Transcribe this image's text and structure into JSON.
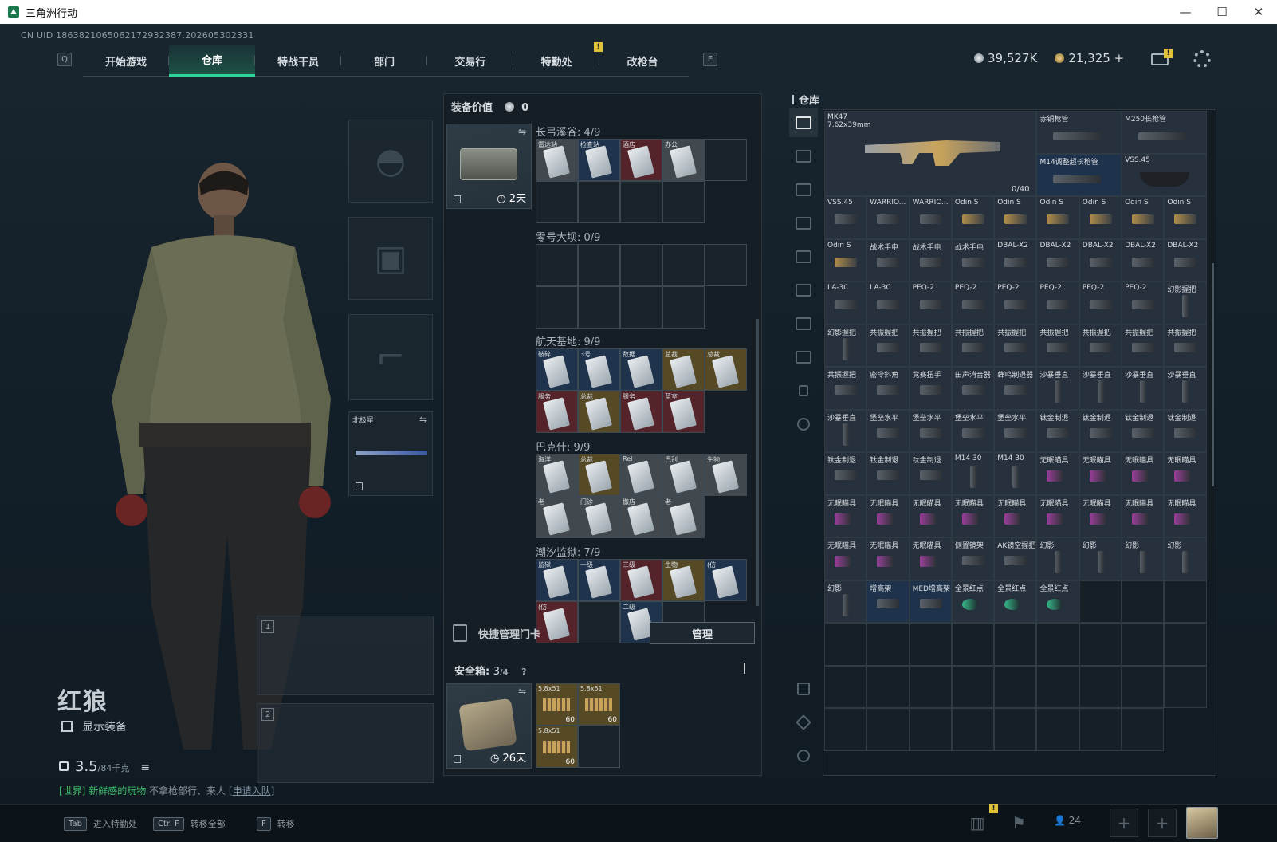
{
  "window": {
    "title": "三角洲行动",
    "controls": [
      "—",
      "☐",
      "✕"
    ]
  },
  "uid": "CN UID 1863821065062172932387.202605302331",
  "nav": {
    "left_key": "Q",
    "right_key": "E",
    "tabs": [
      "开始游戏",
      "仓库",
      "特战干员",
      "部门",
      "交易行",
      "特勤处",
      "改枪台"
    ],
    "active_tab": "仓库",
    "badge": "!"
  },
  "currency": {
    "silver": "39,527K",
    "gold": "21,325",
    "add": "+"
  },
  "mail_badge": "!",
  "character": {
    "name": "红狼",
    "show_gear": "显示装备",
    "weight": "3.5",
    "weight_max": "/84千克"
  },
  "chat": {
    "channel": "[世界]",
    "name": "新鲜感的玩物",
    "text": "不拿枪部行、来人",
    "link": "[申请入队]"
  },
  "gear": {
    "item_label": "北极星"
  },
  "weapon_slots": [
    "1",
    "2"
  ],
  "equip_value": {
    "label": "装备价值",
    "value": "0"
  },
  "card_case": {
    "timer": "2天"
  },
  "card_sections": [
    {
      "title": "长弓溪谷: 4/9",
      "cells": [
        {
          "l": "雷达站",
          "c": "w"
        },
        {
          "l": "检查站",
          "c": "b"
        },
        {
          "l": "酒店",
          "c": "r"
        },
        {
          "l": "办公",
          "c": "w"
        },
        {
          "l": "",
          "c": "empty"
        },
        {
          "l": "",
          "c": "empty"
        },
        {
          "l": "",
          "c": "empty"
        },
        {
          "l": "",
          "c": "empty"
        },
        {
          "l": "",
          "c": "empty"
        }
      ]
    },
    {
      "title": "零号大坝: 0/9",
      "cells": [
        {
          "l": "",
          "c": "empty"
        },
        {
          "l": "",
          "c": "empty"
        },
        {
          "l": "",
          "c": "empty"
        },
        {
          "l": "",
          "c": "empty"
        },
        {
          "l": "",
          "c": "empty"
        },
        {
          "l": "",
          "c": "empty"
        },
        {
          "l": "",
          "c": "empty"
        },
        {
          "l": "",
          "c": "empty"
        },
        {
          "l": "",
          "c": "empty"
        }
      ]
    },
    {
      "title": "航天基地: 9/9",
      "cells": [
        {
          "l": "破碎",
          "c": "b"
        },
        {
          "l": "3号",
          "c": "b"
        },
        {
          "l": "数据",
          "c": "b"
        },
        {
          "l": "总裁",
          "c": "g"
        },
        {
          "l": "总裁",
          "c": "g"
        },
        {
          "l": "服务",
          "c": "r"
        },
        {
          "l": "总裁",
          "c": "g"
        },
        {
          "l": "服务",
          "c": "r"
        },
        {
          "l": "蓝室",
          "c": "r"
        }
      ]
    },
    {
      "title": "巴克什: 9/9",
      "cells": [
        {
          "l": "海洋",
          "c": "w"
        },
        {
          "l": "总裁",
          "c": "g"
        },
        {
          "l": "Rel",
          "c": "w"
        },
        {
          "l": "巴别",
          "c": "w"
        },
        {
          "l": "生物",
          "c": "w"
        },
        {
          "l": "老",
          "c": "w"
        },
        {
          "l": "门诊",
          "c": "w"
        },
        {
          "l": "撤店",
          "c": "w"
        },
        {
          "l": "老",
          "c": "w"
        }
      ]
    },
    {
      "title": "潮汐监狱: 7/9",
      "cells": [
        {
          "l": "监狱",
          "c": "b"
        },
        {
          "l": "一级",
          "c": "b"
        },
        {
          "l": "三级",
          "c": "r"
        },
        {
          "l": "生物",
          "c": "g"
        },
        {
          "l": "(仿",
          "c": "b"
        },
        {
          "l": "(仿",
          "c": "r"
        },
        {
          "l": "",
          "c": "empty"
        },
        {
          "l": "二级",
          "c": "b"
        },
        {
          "l": "",
          "c": "empty"
        }
      ]
    }
  ],
  "quick_card": {
    "label": "快捷管理门卡",
    "button": "管理"
  },
  "safebox": {
    "label": "安全箱: ",
    "count": "3",
    "max": "/4",
    "help": "?",
    "timer": "26天",
    "ammo": [
      {
        "l": "5.8x51",
        "n": "60"
      },
      {
        "l": "5.8x51",
        "n": "60"
      },
      {
        "l": "5.8x51",
        "n": "60"
      }
    ]
  },
  "warehouse": {
    "title": "仓库",
    "ak": {
      "name": "MK47",
      "caliber": "7.62x39mm",
      "ammo": "0/40"
    },
    "top_cells": [
      {
        "l": "赤铜枪管",
        "c": ""
      },
      {
        "l": "M250长枪管",
        "c": ""
      },
      {
        "l": "M14调整超长枪管",
        "c": "blue"
      },
      {
        "l": "VSS.45",
        "c": "mag"
      }
    ],
    "cells": [
      {
        "l": "VSS.45",
        "c": "mag"
      },
      {
        "l": "WARRIO...",
        "c": ""
      },
      {
        "l": "WARRIO...",
        "c": ""
      },
      {
        "l": "Odin S",
        "c": "gold"
      },
      {
        "l": "Odin S",
        "c": "gold"
      },
      {
        "l": "Odin S",
        "c": "gold"
      },
      {
        "l": "Odin S",
        "c": "gold"
      },
      {
        "l": "Odin S",
        "c": "gold"
      },
      {
        "l": "Odin S",
        "c": "gold"
      },
      {
        "l": "Odin S",
        "c": "gold"
      },
      {
        "l": "战术手电",
        "c": ""
      },
      {
        "l": "战术手电",
        "c": ""
      },
      {
        "l": "战术手电",
        "c": ""
      },
      {
        "l": "DBAL-X2",
        "c": ""
      },
      {
        "l": "DBAL-X2",
        "c": ""
      },
      {
        "l": "DBAL-X2",
        "c": ""
      },
      {
        "l": "DBAL-X2",
        "c": ""
      },
      {
        "l": "DBAL-X2",
        "c": ""
      },
      {
        "l": "LA-3C",
        "c": ""
      },
      {
        "l": "LA-3C",
        "c": ""
      },
      {
        "l": "PEQ-2",
        "c": ""
      },
      {
        "l": "PEQ-2",
        "c": ""
      },
      {
        "l": "PEQ-2",
        "c": ""
      },
      {
        "l": "PEQ-2",
        "c": ""
      },
      {
        "l": "PEQ-2",
        "c": ""
      },
      {
        "l": "PEQ-2",
        "c": ""
      },
      {
        "l": "幻影握把",
        "c": "tall"
      },
      {
        "l": "幻影握把",
        "c": "tall"
      },
      {
        "l": "共振握把",
        "c": ""
      },
      {
        "l": "共振握把",
        "c": ""
      },
      {
        "l": "共振握把",
        "c": ""
      },
      {
        "l": "共振握把",
        "c": ""
      },
      {
        "l": "共振握把",
        "c": ""
      },
      {
        "l": "共振握把",
        "c": ""
      },
      {
        "l": "共振握把",
        "c": ""
      },
      {
        "l": "共振握把",
        "c": ""
      },
      {
        "l": "共振握把",
        "c": ""
      },
      {
        "l": "密令斜角",
        "c": ""
      },
      {
        "l": "竞赛扭手",
        "c": ""
      },
      {
        "l": "田声消音器",
        "c": ""
      },
      {
        "l": "蜂鸣制退器",
        "c": ""
      },
      {
        "l": "沙暴垂直",
        "c": "tall"
      },
      {
        "l": "沙暴垂直",
        "c": "tall"
      },
      {
        "l": "沙暴垂直",
        "c": "tall"
      },
      {
        "l": "沙暴垂直",
        "c": "tall"
      },
      {
        "l": "沙暴垂直",
        "c": "tall"
      },
      {
        "l": "堡垒水平",
        "c": ""
      },
      {
        "l": "堡垒水平",
        "c": ""
      },
      {
        "l": "堡垒水平",
        "c": ""
      },
      {
        "l": "堡垒水平",
        "c": ""
      },
      {
        "l": "钛金制退",
        "c": ""
      },
      {
        "l": "钛金制退",
        "c": ""
      },
      {
        "l": "钛金制退",
        "c": ""
      },
      {
        "l": "钛金制退",
        "c": ""
      },
      {
        "l": "钛金制退",
        "c": ""
      },
      {
        "l": "钛金制退",
        "c": ""
      },
      {
        "l": "钛金制退",
        "c": ""
      },
      {
        "l": "M14 30",
        "c": "tall"
      },
      {
        "l": "M14 30",
        "c": "tall"
      },
      {
        "l": "无眠瞄具",
        "c": "purple"
      },
      {
        "l": "无眠瞄具",
        "c": "purple"
      },
      {
        "l": "无眠瞄具",
        "c": "purple"
      },
      {
        "l": "无眠瞄具",
        "c": "purple"
      },
      {
        "l": "无眠瞄具",
        "c": "purple"
      },
      {
        "l": "无眠瞄具",
        "c": "purple"
      },
      {
        "l": "无眠瞄具",
        "c": "purple"
      },
      {
        "l": "无眠瞄具",
        "c": "purple"
      },
      {
        "l": "无眠瞄具",
        "c": "purple"
      },
      {
        "l": "无眠瞄具",
        "c": "purple"
      },
      {
        "l": "无眠瞄具",
        "c": "purple"
      },
      {
        "l": "无眠瞄具",
        "c": "purple"
      },
      {
        "l": "无眠瞄具",
        "c": "purple"
      },
      {
        "l": "无眠瞄具",
        "c": "purple"
      },
      {
        "l": "无眠瞄具",
        "c": "purple"
      },
      {
        "l": "无眠瞄具",
        "c": "purple"
      },
      {
        "l": "侧置镜架",
        "c": ""
      },
      {
        "l": "AK镜空握把",
        "c": ""
      },
      {
        "l": "幻影",
        "c": "tall"
      },
      {
        "l": "幻影",
        "c": "tall"
      },
      {
        "l": "幻影",
        "c": "tall"
      },
      {
        "l": "幻影",
        "c": "tall"
      },
      {
        "l": "幻影",
        "c": "tall"
      },
      {
        "l": "增高架",
        "c": "blue"
      },
      {
        "l": "MED增高架",
        "c": "blue"
      },
      {
        "l": "全景红点",
        "c": "green"
      },
      {
        "l": "全景红点",
        "c": "green"
      },
      {
        "l": "全景红点",
        "c": "green"
      },
      {
        "l": "",
        "c": "empty"
      },
      {
        "l": "",
        "c": "empty"
      }
    ]
  },
  "bottom": {
    "keys": [
      {
        "k": "Tab",
        "t": "进入特勤处"
      },
      {
        "k": "Ctrl F",
        "t": "转移全部"
      },
      {
        "k": "F",
        "t": "转移"
      }
    ],
    "team_count": "24",
    "add": "+"
  }
}
